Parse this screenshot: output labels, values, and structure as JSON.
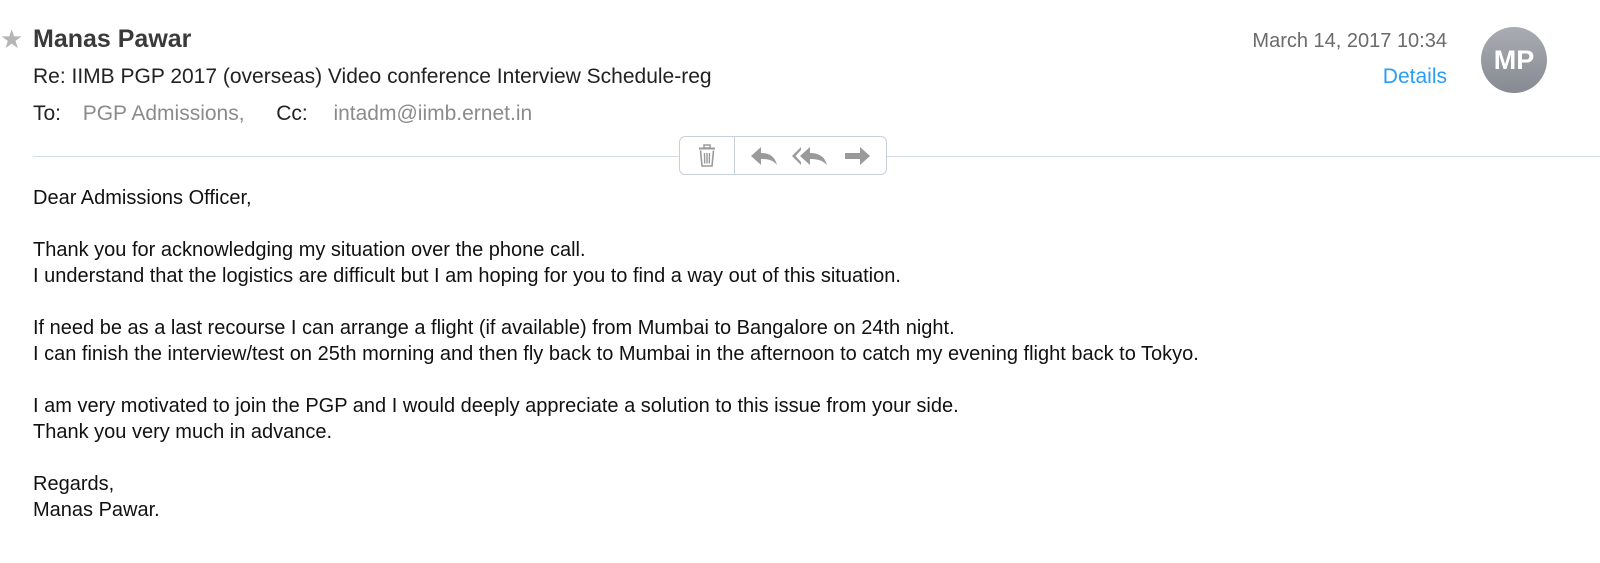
{
  "message": {
    "sender": "Manas Pawar",
    "subject": "Re: IIMB PGP 2017 (overseas) Video conference Interview Schedule-reg",
    "to_label": "To:",
    "to_value": "PGP Admissions,",
    "cc_label": "Cc:",
    "cc_value": "intadm@iimb.ernet.in",
    "date": "March 14, 2017 10:34",
    "details_label": "Details",
    "avatar_initials": "MP"
  },
  "toolbar": {
    "icons": [
      "trash-icon",
      "reply-icon",
      "reply-all-icon",
      "forward-icon"
    ]
  },
  "body": {
    "greeting": "Dear Admissions Officer,",
    "p1_l1": "Thank you for acknowledging my situation over the phone call.",
    "p1_l2": "I understand that the logistics are difficult but I am hoping for you to find a way out of this situation.",
    "p2_l1": "If need be as a last recourse I can arrange a flight (if available) from Mumbai to Bangalore on 24th night.",
    "p2_l2": "I can finish the interview/test on 25th morning and then fly back to Mumbai in the afternoon to catch my evening flight back to Tokyo.",
    "p3_l1": "I am very motivated to join the PGP and I would deeply appreciate a solution to this issue from your side.",
    "p3_l2": "Thank you very much in advance.",
    "sign_l1": "Regards,",
    "sign_l2": "Manas Pawar."
  },
  "colors": {
    "accent": "#2a9df4",
    "avatar": "#9a9da4"
  }
}
